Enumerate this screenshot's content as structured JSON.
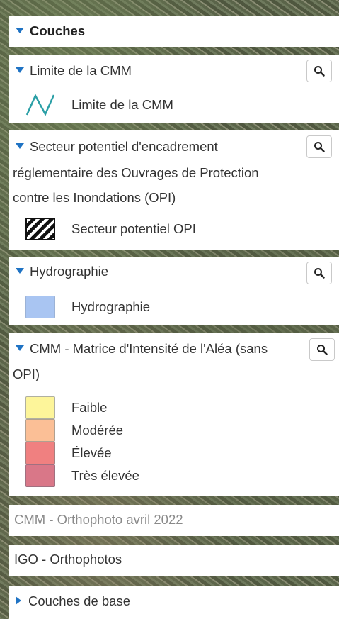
{
  "layers_header": {
    "title": "Couches"
  },
  "groups": [
    {
      "title": "Limite de la CMM",
      "zoom_icon": "magnifier-icon",
      "legend": [
        {
          "label": "Limite de la CMM",
          "icon": "zigzag-line-icon",
          "color": "#2a9fa6"
        }
      ]
    },
    {
      "title_lines": [
        "Secteur potentiel d'encadrement",
        "réglementaire des Ouvrages de Protection",
        "contre les Inondations (OPI)"
      ],
      "zoom_icon": "magnifier-icon",
      "legend": [
        {
          "label": "Secteur potentiel OPI",
          "icon": "hatched-box-icon"
        }
      ]
    },
    {
      "title": "Hydrographie",
      "zoom_icon": "magnifier-icon",
      "legend": [
        {
          "label": "Hydrographie",
          "color": "#a9c5f2"
        }
      ]
    },
    {
      "title_lines": [
        "CMM - Matrice d'Intensité de l'Aléa (sans",
        "OPI)"
      ],
      "zoom_icon": "magnifier-icon",
      "legend": [
        {
          "label": "Faible",
          "color": "#fdf59a"
        },
        {
          "label": "Modérée",
          "color": "#fbbf96"
        },
        {
          "label": "Élevée",
          "color": "#f08080"
        },
        {
          "label": "Très élevée",
          "color": "#d97788"
        }
      ]
    }
  ],
  "flat_layers": [
    {
      "label": "CMM - Orthophoto avril 2022"
    },
    {
      "label": "IGO - Orthophotos"
    }
  ],
  "base_layers": {
    "title": "Couches de base"
  },
  "colors": {
    "accent": "#1f73c4",
    "panel": "#ffffff",
    "border": "#c9c9c9"
  }
}
